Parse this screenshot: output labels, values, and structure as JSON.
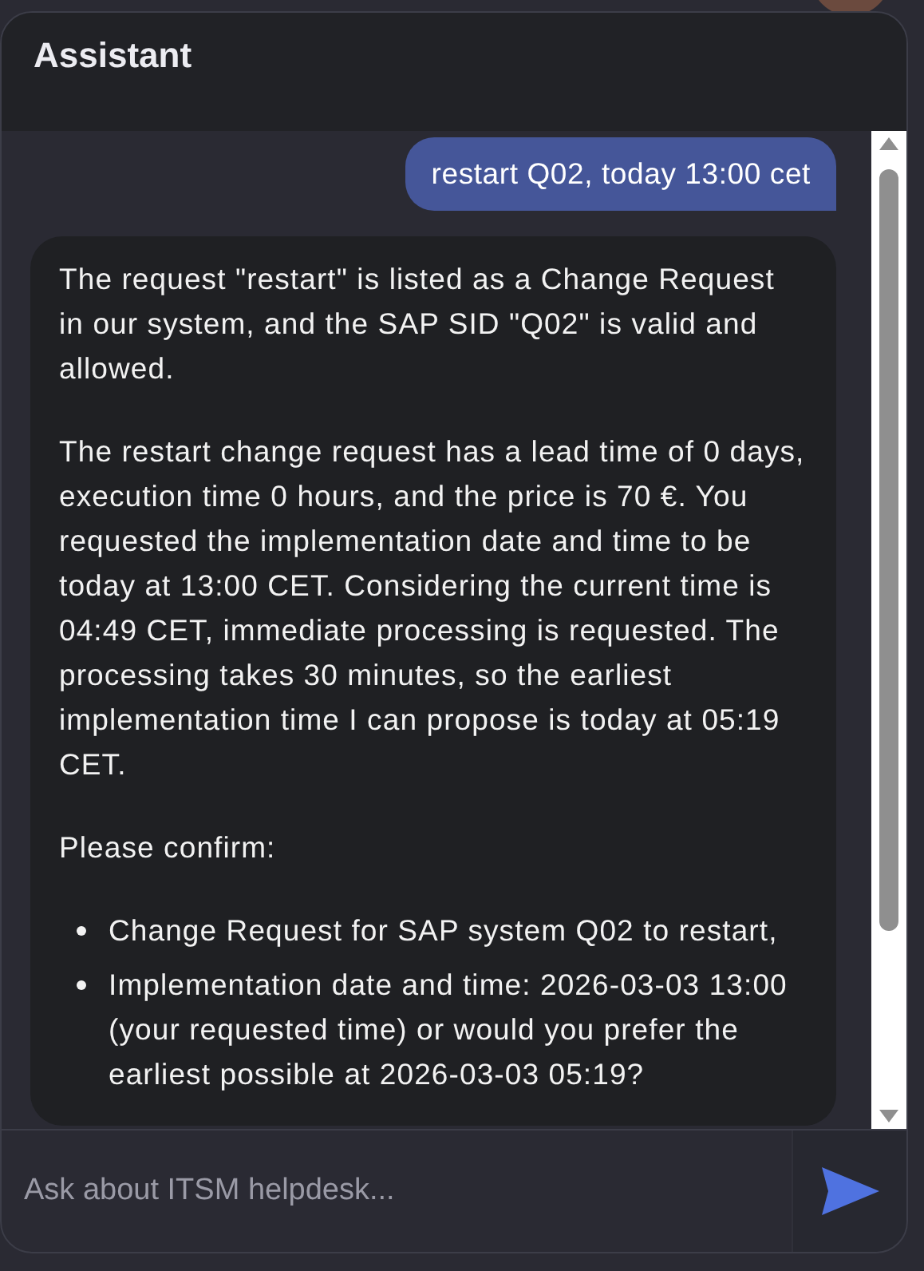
{
  "panel": {
    "title": "Assistant"
  },
  "messages": [
    {
      "kind": "user",
      "text": "restart Q02, today 13:00 cet"
    },
    {
      "kind": "assistant",
      "blocks": [
        {
          "kind": "paragraph",
          "text": "The request \"restart\" is listed as a Change Request in our system, and the SAP SID \"Q02\" is valid and allowed."
        },
        {
          "kind": "paragraph",
          "text": "The restart change request has a lead time of 0 days, execution time 0 hours, and the price is 70 €. You requested the implementation date and time to be today at 13:00 CET. Considering the current time is 04:49 CET, immediate processing is requested. The processing takes 30 minutes, so the earliest implementation time I can propose is today at 05:19 CET."
        },
        {
          "kind": "paragraph",
          "text": "Please confirm:"
        },
        {
          "kind": "list",
          "items": [
            "Change Request for SAP system Q02 to restart,",
            "Implementation date and time: 2026-03-03 13:00 (your requested time) or would you prefer the earliest possible at 2026-03-03 05:19?"
          ]
        }
      ]
    }
  ],
  "composer": {
    "placeholder": "Ask about ITSM helpdesk..."
  }
}
